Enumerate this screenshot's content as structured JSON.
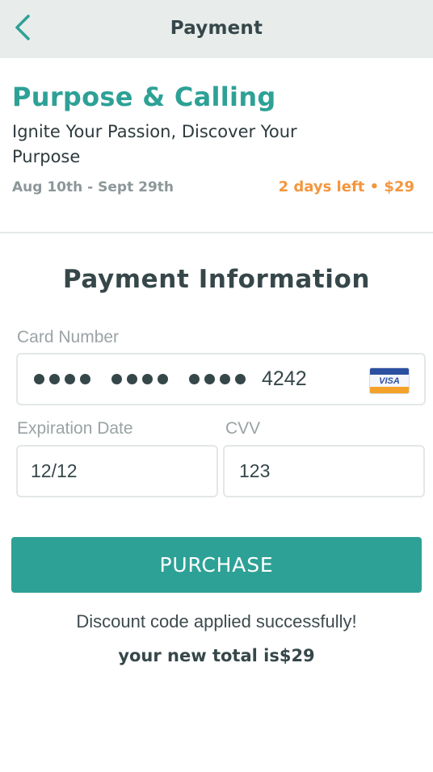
{
  "header": {
    "title": "Payment",
    "back_icon": "chevron-left-icon",
    "accent_color": "#2ea196"
  },
  "course": {
    "title": "Purpose & Calling",
    "subtitle": "Ignite Your Passion, Discover Your Purpose",
    "dates": "Aug 10th - Sept 29th",
    "meta": "2 days left • $29"
  },
  "payment": {
    "section_title": "Payment Information",
    "card_number_label": "Card Number",
    "card_last4": "4242",
    "card_brand": "VISA",
    "card_brand_icon": "visa-card-icon",
    "expiration_label": "Expiration Date",
    "expiration_value": "12/12",
    "cvv_label": "CVV",
    "cvv_value": "123"
  },
  "actions": {
    "purchase_label": "PURCHASE"
  },
  "status": {
    "discount_message": "Discount code applied successfully!",
    "new_total": "your new total is$29"
  },
  "colors": {
    "brand": "#2ea196",
    "highlight": "#f4963d",
    "header_bg": "#e8eceb"
  }
}
